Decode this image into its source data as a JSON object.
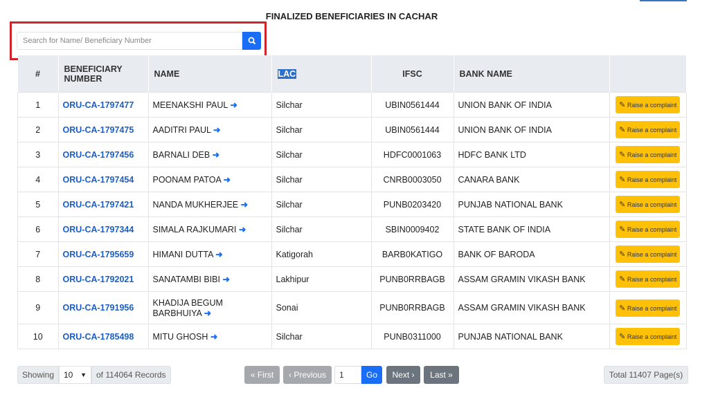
{
  "title": "FINALIZED BENEFICIARIES IN CACHAR",
  "search": {
    "placeholder": "Search for Name/ Beneficiary Number",
    "icon": "search-icon"
  },
  "columns": [
    "#",
    "BENEFICIARY NUMBER",
    "NAME",
    "LAC",
    "IFSC",
    "BANK NAME",
    ""
  ],
  "action_label": "Raise a complaint",
  "rows": [
    {
      "n": "1",
      "id": "ORU-CA-1797477",
      "name": "MEENAKSHI PAUL",
      "lac": "Silchar",
      "ifsc": "UBIN0561444",
      "bank": "UNION BANK OF INDIA"
    },
    {
      "n": "2",
      "id": "ORU-CA-1797475",
      "name": "AADITRI PAUL",
      "lac": "Silchar",
      "ifsc": "UBIN0561444",
      "bank": "UNION BANK OF INDIA"
    },
    {
      "n": "3",
      "id": "ORU-CA-1797456",
      "name": "BARNALI DEB",
      "lac": "Silchar",
      "ifsc": "HDFC0001063",
      "bank": "HDFC BANK LTD"
    },
    {
      "n": "4",
      "id": "ORU-CA-1797454",
      "name": "POONAM PATOA",
      "lac": "Silchar",
      "ifsc": "CNRB0003050",
      "bank": "CANARA BANK"
    },
    {
      "n": "5",
      "id": "ORU-CA-1797421",
      "name": "NANDA MUKHERJEE",
      "lac": "Silchar",
      "ifsc": "PUNB0203420",
      "bank": "PUNJAB NATIONAL BANK"
    },
    {
      "n": "6",
      "id": "ORU-CA-1797344",
      "name": "SIMALA RAJKUMARI",
      "lac": "Silchar",
      "ifsc": "SBIN0009402",
      "bank": "STATE BANK OF INDIA"
    },
    {
      "n": "7",
      "id": "ORU-CA-1795659",
      "name": "HIMANI DUTTA",
      "lac": "Katigorah",
      "ifsc": "BARB0KATIGO",
      "bank": "BANK OF BARODA"
    },
    {
      "n": "8",
      "id": "ORU-CA-1792021",
      "name": "SANATAMBI BIBI",
      "lac": "Lakhipur",
      "ifsc": "PUNB0RRBAGB",
      "bank": "ASSAM GRAMIN VIKASH BANK"
    },
    {
      "n": "9",
      "id": "ORU-CA-1791956",
      "name": "KHADIJA BEGUM BARBHUIYA",
      "lac": "Sonai",
      "ifsc": "PUNB0RRBAGB",
      "bank": "ASSAM GRAMIN VIKASH BANK"
    },
    {
      "n": "10",
      "id": "ORU-CA-1785498",
      "name": "MITU GHOSH",
      "lac": "Silchar",
      "ifsc": "PUNB0311000",
      "bank": "PUNJAB NATIONAL BANK"
    }
  ],
  "footer": {
    "showing": "Showing",
    "page_size": "10",
    "records": "of 114064 Records",
    "first": "« First",
    "previous": "‹ Previous",
    "page": "1",
    "go": "Go",
    "next": "Next ›",
    "last": "Last »",
    "total": "Total 11407 Page(s)"
  }
}
